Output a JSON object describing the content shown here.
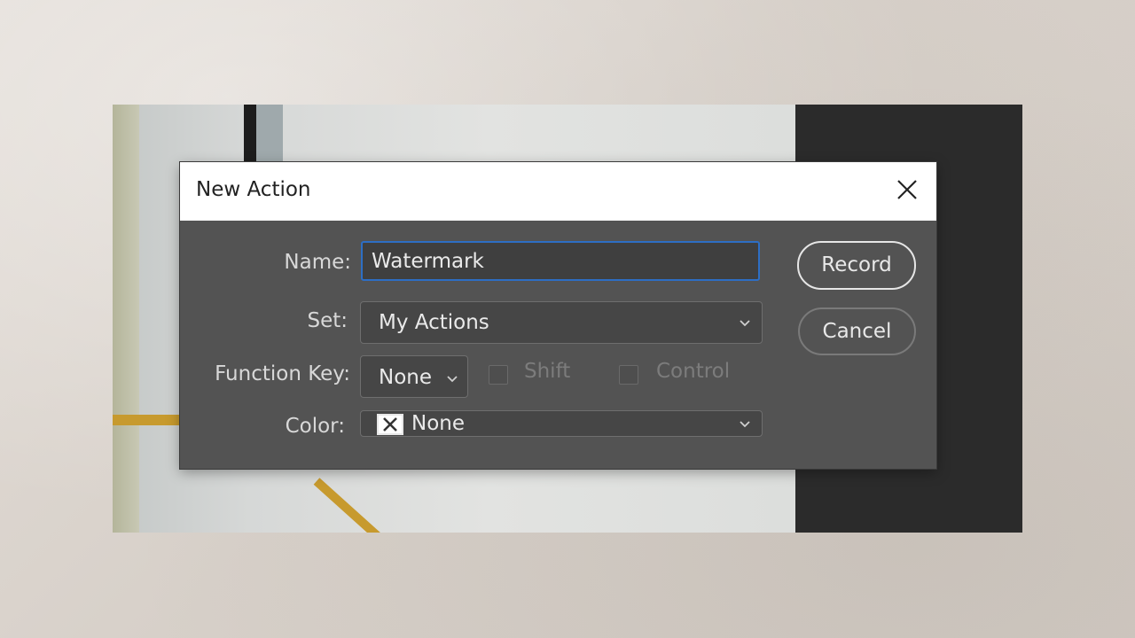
{
  "dialog": {
    "title": "New Action",
    "close_icon": "close-icon"
  },
  "form": {
    "name_label": "Name:",
    "name_value": "Watermark",
    "set_label": "Set:",
    "set_value": "My Actions",
    "function_key_label": "Function Key:",
    "function_key_value": "None",
    "shift_label": "Shift",
    "shift_checked": false,
    "control_label": "Control",
    "control_checked": false,
    "color_label": "Color:",
    "color_value": "None"
  },
  "buttons": {
    "record": "Record",
    "cancel": "Cancel"
  },
  "colors": {
    "dialog_bg": "#535353",
    "focus_border": "#2d6ec4",
    "text": "#d8d8d8",
    "disabled_text": "#7c7c7c"
  }
}
